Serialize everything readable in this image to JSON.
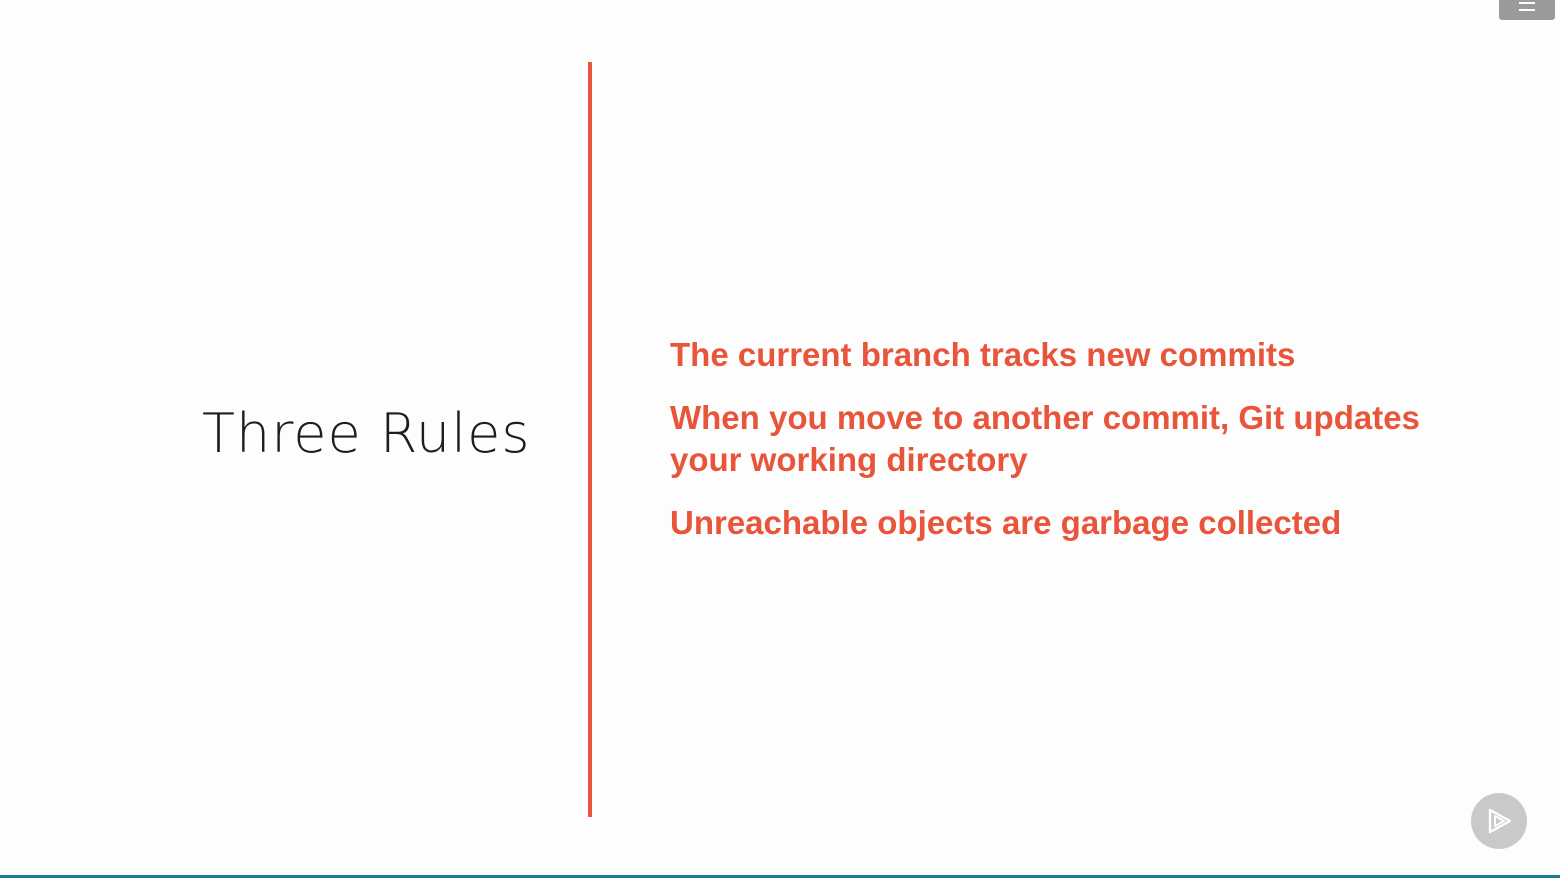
{
  "slide": {
    "title": "Three Rules",
    "rules": [
      "The current branch tracks new commits",
      "When you move to another commit, Git updates your working directory",
      "Unreachable objects are garbage collected"
    ]
  },
  "controls": {
    "menu_icon": "hamburger-icon",
    "play_icon": "play-icon"
  },
  "colors": {
    "accent": "#e8553a",
    "title_text": "#1d1d1d",
    "background": "#fdfdfd",
    "progress_bar": "#1a7a9b"
  }
}
